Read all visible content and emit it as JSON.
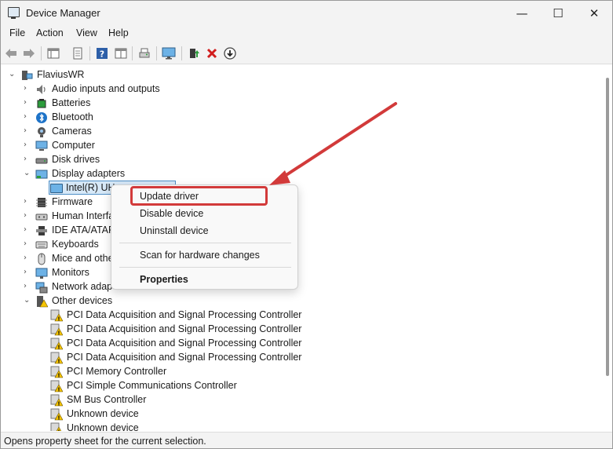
{
  "window": {
    "title": "Device Manager"
  },
  "menu": [
    "File",
    "Action",
    "View",
    "Help"
  ],
  "tree": {
    "root": "FlaviusWR",
    "categories": [
      "Audio inputs and outputs",
      "Batteries",
      "Bluetooth",
      "Cameras",
      "Computer",
      "Disk drives",
      "Display adapters",
      "Firmware",
      "Human Interfa",
      "IDE ATA/ATAP",
      "Keyboards",
      "Mice and othe",
      "Monitors",
      "Network adap",
      "Other devices"
    ],
    "display_child": "Intel(R) UHD Graphics 620",
    "display_child_visible": "Intel(R) UH",
    "other_devices": [
      "PCI Data Acquisition and Signal Processing Controller",
      "PCI Data Acquisition and Signal Processing Controller",
      "PCI Data Acquisition and Signal Processing Controller",
      "PCI Data Acquisition and Signal Processing Controller",
      "PCI Memory Controller",
      "PCI Simple Communications Controller",
      "SM Bus Controller",
      "Unknown device",
      "Unknown device"
    ]
  },
  "context_menu": {
    "items": [
      "Update driver",
      "Disable device",
      "Uninstall device",
      "Scan for hardware changes",
      "Properties"
    ]
  },
  "status": {
    "text": "Opens property sheet for the current selection."
  },
  "icons": {
    "back": "back-arrow-icon",
    "forward": "forward-arrow-icon",
    "enable": "enable-device-icon",
    "uninstall": "uninstall-x-icon",
    "download": "download-icon"
  },
  "colors": {
    "highlight": "#d23a3a",
    "selection": "#d6e8f7",
    "accent": "#2f5f88"
  }
}
